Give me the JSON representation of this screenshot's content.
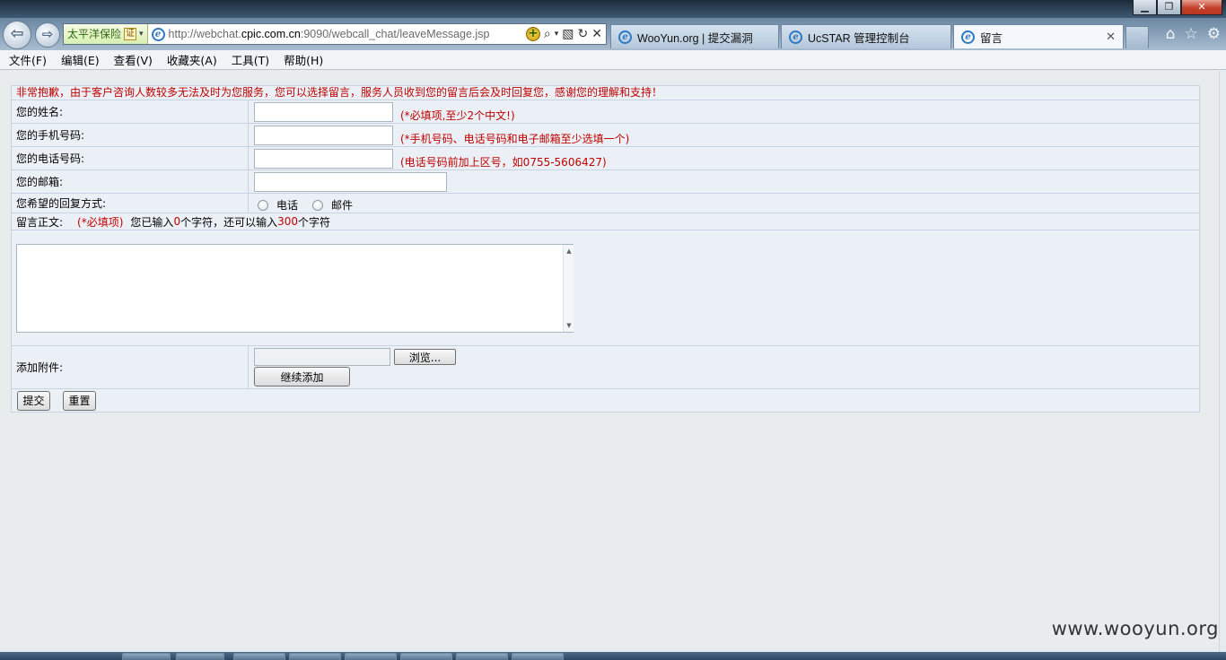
{
  "browser": {
    "address_cert": "太平洋保险",
    "address_cert_badge": "证",
    "url_prefix": "http://webchat.",
    "url_domain": "cpic.com.cn",
    "url_suffix": ":9090/webcall_chat/leaveMessage.jsp",
    "tabs": [
      {
        "label": "WooYun.org | 提交漏洞"
      },
      {
        "label": "UcSTAR 管理控制台"
      },
      {
        "label": "留言"
      }
    ],
    "menu": [
      "文件(F)",
      "编辑(E)",
      "查看(V)",
      "收藏夹(A)",
      "工具(T)",
      "帮助(H)"
    ]
  },
  "form": {
    "notice": "非常抱歉，由于客户咨询人数较多无法及时为您服务，您可以选择留言，服务人员收到您的留言后会及时回复您，感谢您的理解和支持！",
    "name_label": "您的姓名:",
    "name_value": "",
    "name_hint": "(*必填项,至少2个中文!)",
    "mobile_label": "您的手机号码:",
    "mobile_value": "",
    "mobile_hint": "(*手机号码、电话号码和电子邮箱至少选填一个)",
    "phone_label": "您的电话号码:",
    "phone_value": "",
    "phone_hint": "(电话号码前加上区号，如0755-5606427)",
    "email_label": "您的邮箱:",
    "email_value": "",
    "reply_label": "您希望的回复方式:",
    "reply_options": [
      "电话",
      "邮件"
    ],
    "content_label": "留言正文:",
    "content_required": "(*必填项)",
    "content_count_prefix": "您已输入",
    "content_count_entered": "0",
    "content_count_mid": "个字符，还可以输入",
    "content_count_remaining": "300",
    "content_count_suffix": "个字符",
    "content_value": "",
    "attach_label": "添加附件:",
    "browse_button": "浏览...",
    "add_more_button": "继续添加",
    "submit_button": "提交",
    "reset_button": "重置"
  },
  "watermark": "www.wooyun.org"
}
